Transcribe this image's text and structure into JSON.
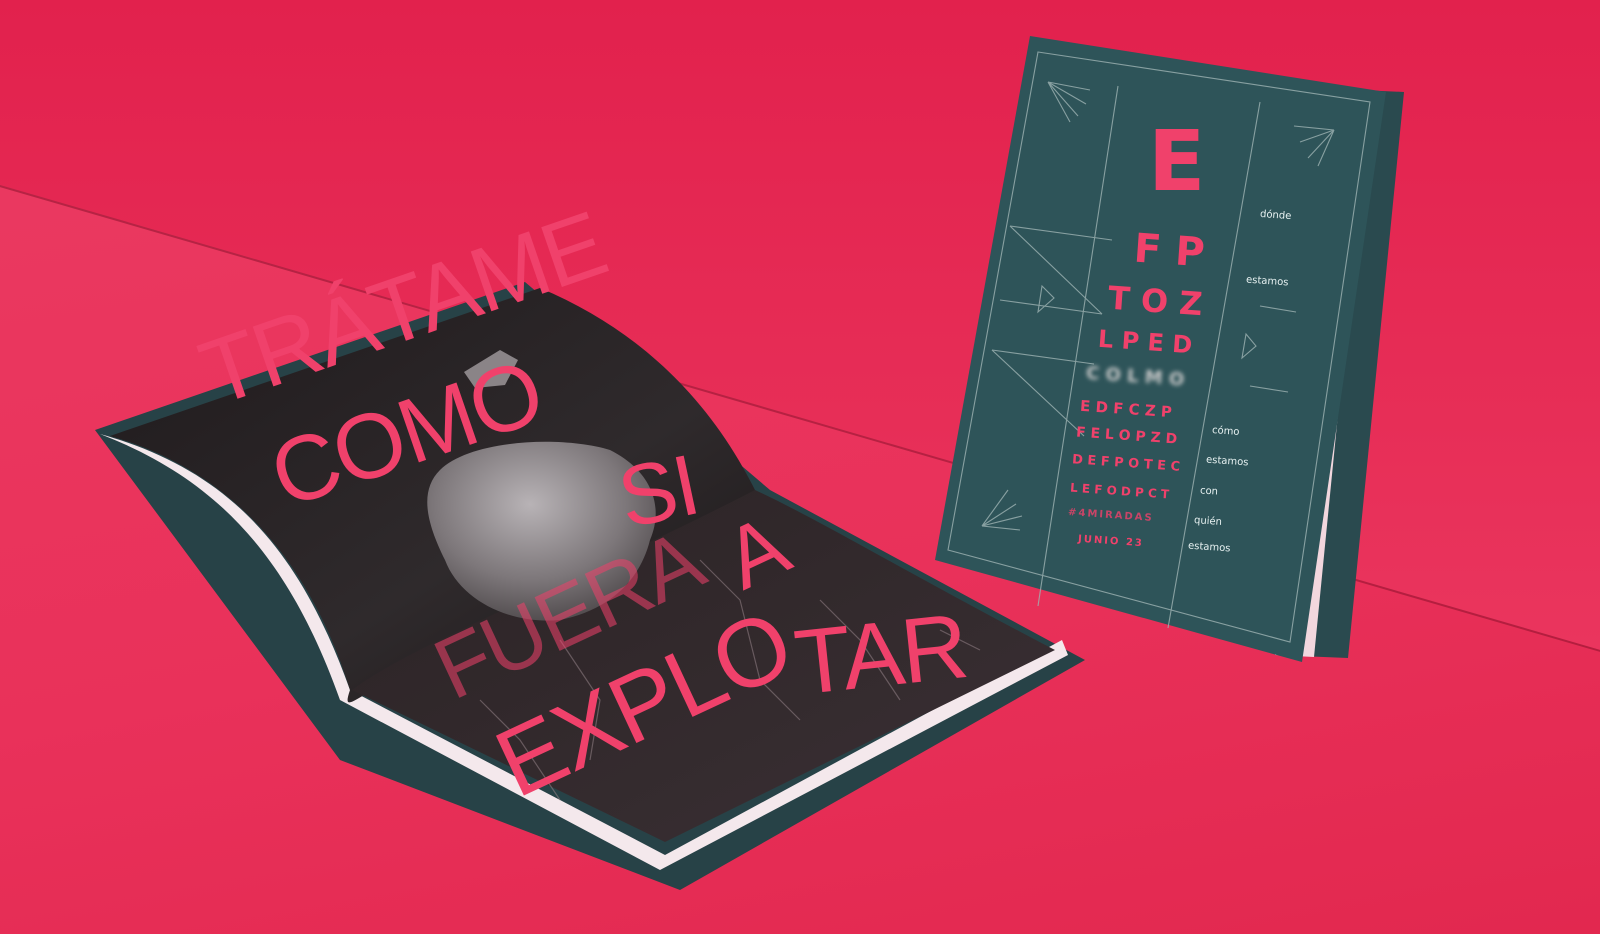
{
  "colors": {
    "background": "#e8325a",
    "cover": "#2e5459",
    "accent": "#f0416b",
    "spread": "#2a2526"
  },
  "cover": {
    "chart_rows": [
      "E",
      "F P",
      "T O Z",
      "L P E D",
      "C O L M O",
      "E D F C Z P",
      "F E L O P Z D",
      "D E F P O T E C",
      "L E F O D P C T"
    ],
    "hashtag": "#4MIRADAS",
    "date": "JUNIO 23",
    "side_words": [
      "dónde",
      "estamos",
      "cómo",
      "estamos",
      "con",
      "quién",
      "estamos"
    ]
  },
  "spread": {
    "left_lines": [
      "TRÁTAME",
      "COMO",
      "SI"
    ],
    "right_lines": [
      "FUERA",
      "A",
      "EXPLO",
      "TAR"
    ]
  }
}
